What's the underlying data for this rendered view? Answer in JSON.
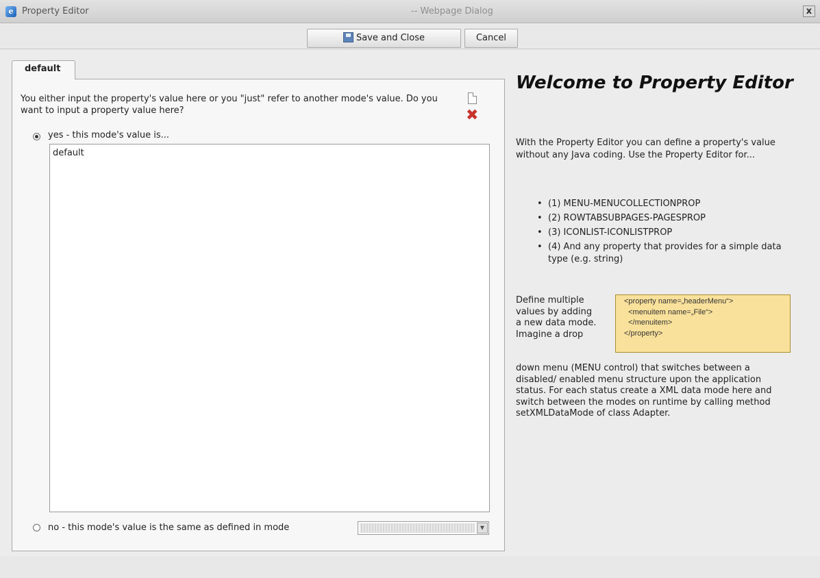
{
  "window": {
    "title": "Property Editor",
    "title_suffix": "-- Webpage Dialog",
    "close_glyph": "x",
    "app_icon_glyph": "e"
  },
  "toolbar": {
    "save_label": "Save and Close",
    "cancel_label": "Cancel"
  },
  "tab": {
    "label": "default"
  },
  "editor": {
    "question": "You either input the property's value here or you \"just\" refer to another mode's value. Do you want to input a property value here?",
    "delete_glyph": "✖",
    "yes_label": "yes - this mode's value is...",
    "yes_selected": true,
    "value": "default",
    "no_label": "no - this mode's value is the same as defined in mode",
    "mode_select_value": "",
    "dropdown_glyph": "▼"
  },
  "help": {
    "title": "Welcome to Property Editor",
    "intro": "With the Property Editor you can define a property's value without any Java coding. Use the Property Editor for...",
    "items": [
      "(1) MENU-MENUCOLLECTIONPROP",
      "(2) ROWTABSUBPAGES-PAGESPROP",
      "(3) ICONLIST-ICONLISTPROP",
      "(4) And any property that provides for a simple data type (e.g. string)"
    ],
    "define_text": "Define multiple values by adding a new data mode. Imagine a drop",
    "rest_text": "down menu (MENU control) that switches between a disabled/ enabled menu structure upon the application status. For each status create a XML data mode here and switch between the modes on runtime by calling method setXMLDataMode of class Adapter.",
    "code_lines": [
      "<property name=„headerMenu“>",
      "  <menuitem name=„File“>",
      "  </menuitem>",
      "</property>"
    ]
  }
}
